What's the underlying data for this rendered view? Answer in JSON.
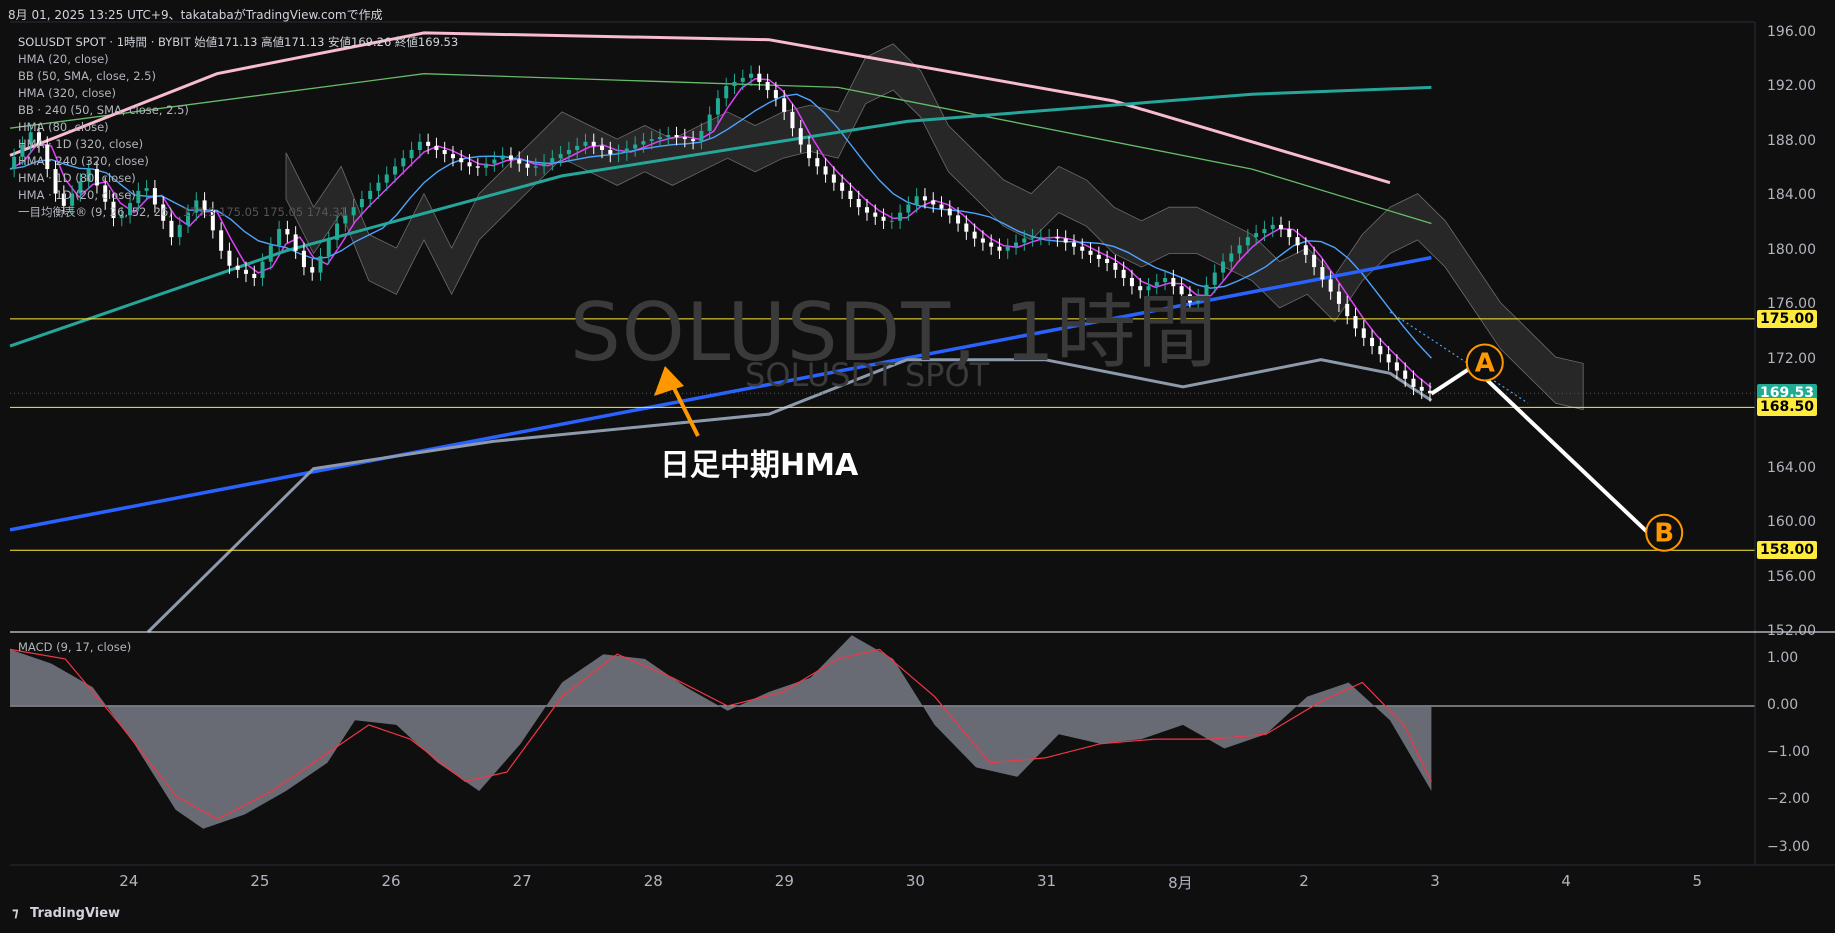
{
  "header": {
    "text": "8月 01, 2025 13:25 UTC+9、takatabaがTradingView.comで作成"
  },
  "legend": {
    "symbol_line": "SOLUSDT SPOT · 1時間 · BYBIT",
    "ohlc": "始値171.13 高値171.13 安値169.26 終値169.53",
    "items": [
      "HMA (20, close)",
      "BB (50, SMA, close, 2.5)",
      "HMA (320, close)",
      "BB · 240 (50, SMA, close, 2.5)",
      "HMA (80, close)",
      "HMA · 1D (320, close)",
      "HMA · 240 (320, close)",
      "HMA · 1D (80, close)",
      "HMA · 1D (20, close)",
      "一目均衡表® (9, 26, 52, 26)"
    ],
    "ichimoku_values": "173.3   175.05   175.05   174.31"
  },
  "watermark": {
    "main": "SOLUSDT, 1時間",
    "sub": "SOLUSDT SPOT"
  },
  "annotation": {
    "text": "日足中期HMA",
    "point_a": "A",
    "point_b": "B"
  },
  "price_tags": [
    {
      "label": "175.00",
      "value": 175.0,
      "bg": "#ffeb3b",
      "fg": "#000000"
    },
    {
      "label": "169.53",
      "value": 169.53,
      "bg": "#22ab94",
      "fg": "#ffffff"
    },
    {
      "label": "168.50",
      "value": 168.5,
      "bg": "#ffeb3b",
      "fg": "#000000"
    },
    {
      "label": "158.00",
      "value": 158.0,
      "bg": "#ffeb3b",
      "fg": "#000000"
    }
  ],
  "macd_label": "MACD (9, 17, close)",
  "footer": {
    "logo_text": "TradingView"
  },
  "colors": {
    "background": "#0f0f0f",
    "up_candle": "#22ab94",
    "down_candle": "#ffffff",
    "hma_pink": "#f8bbd0",
    "hma_teal": "#26a69a",
    "hma_blue_daily": "#2962ff",
    "hma_gray": "#8d9aab",
    "hma_magenta": "#e040fb",
    "hma_lightblue": "#4fa3ff",
    "hma_green": "#66bb6a",
    "horizontal_line": "#ffeb3b",
    "arrow": "#ff9800",
    "macd_hist": "#787b86",
    "macd_signal": "#f23645"
  },
  "chart_data": [
    {
      "type": "candlestick",
      "x_ticks": [
        "24",
        "25",
        "26",
        "27",
        "28",
        "29",
        "30",
        "31",
        "8月",
        "2",
        "3",
        "4",
        "5"
      ],
      "y_ticks": [
        "196.00",
        "192.00",
        "188.00",
        "184.00",
        "180.00",
        "176.00",
        "172.00",
        "164.00",
        "160.00",
        "156.00",
        "152.00"
      ],
      "ylim": [
        152,
        196.8
      ],
      "horizontal_levels": [
        175.0,
        168.5,
        158.0
      ],
      "last_price": 169.53,
      "close_path": [
        [
          0,
          186
        ],
        [
          4,
          189
        ],
        [
          8,
          183
        ],
        [
          12,
          186
        ],
        [
          16,
          182
        ],
        [
          20,
          185
        ],
        [
          24,
          181
        ],
        [
          28,
          184
        ],
        [
          32,
          179
        ],
        [
          36,
          178
        ],
        [
          40,
          182
        ],
        [
          44,
          178
        ],
        [
          48,
          182
        ],
        [
          52,
          184
        ],
        [
          56,
          186
        ],
        [
          60,
          188
        ],
        [
          64,
          187
        ],
        [
          68,
          186
        ],
        [
          72,
          187
        ],
        [
          76,
          186
        ],
        [
          80,
          187
        ],
        [
          84,
          188
        ],
        [
          88,
          187
        ],
        [
          92,
          188
        ],
        [
          96,
          188.5
        ],
        [
          100,
          188
        ],
        [
          104,
          192
        ],
        [
          108,
          193
        ],
        [
          112,
          191
        ],
        [
          116,
          187
        ],
        [
          120,
          185
        ],
        [
          124,
          183
        ],
        [
          128,
          182
        ],
        [
          132,
          184
        ],
        [
          136,
          183
        ],
        [
          140,
          181
        ],
        [
          144,
          180
        ],
        [
          148,
          181
        ],
        [
          152,
          181
        ],
        [
          156,
          180
        ],
        [
          160,
          179
        ],
        [
          164,
          177
        ],
        [
          168,
          178
        ],
        [
          172,
          176
        ],
        [
          176,
          179
        ],
        [
          180,
          181
        ],
        [
          184,
          182
        ],
        [
          188,
          180
        ],
        [
          192,
          177
        ],
        [
          196,
          174
        ],
        [
          200,
          172
        ],
        [
          204,
          170
        ],
        [
          206,
          169.53
        ]
      ],
      "projection": {
        "points": [
          [
            206,
            169.5
          ],
          [
            212,
            171.5
          ],
          [
            238,
            159.0
          ]
        ]
      }
    },
    {
      "type": "line",
      "name": "MACD (9, 17, close)",
      "y_ticks": [
        "1.00",
        "0.00",
        "−1.00",
        "−2.00",
        "−3.00"
      ],
      "ylim": [
        -3.2,
        1.4
      ],
      "histogram": [
        [
          0,
          1.2
        ],
        [
          6,
          0.9
        ],
        [
          12,
          0.4
        ],
        [
          18,
          -0.8
        ],
        [
          24,
          -2.2
        ],
        [
          28,
          -2.6
        ],
        [
          34,
          -2.3
        ],
        [
          40,
          -1.8
        ],
        [
          46,
          -1.2
        ],
        [
          50,
          -0.3
        ],
        [
          56,
          -0.4
        ],
        [
          62,
          -1.2
        ],
        [
          68,
          -1.8
        ],
        [
          74,
          -0.8
        ],
        [
          80,
          0.5
        ],
        [
          86,
          1.1
        ],
        [
          92,
          1.0
        ],
        [
          98,
          0.4
        ],
        [
          104,
          -0.1
        ],
        [
          110,
          0.3
        ],
        [
          116,
          0.6
        ],
        [
          122,
          1.5
        ],
        [
          128,
          1.0
        ],
        [
          134,
          -0.4
        ],
        [
          140,
          -1.3
        ],
        [
          146,
          -1.5
        ],
        [
          152,
          -0.6
        ],
        [
          158,
          -0.8
        ],
        [
          164,
          -0.7
        ],
        [
          170,
          -0.4
        ],
        [
          176,
          -0.9
        ],
        [
          182,
          -0.6
        ],
        [
          188,
          0.2
        ],
        [
          194,
          0.5
        ],
        [
          200,
          -0.3
        ],
        [
          206,
          -1.8
        ]
      ],
      "signal": [
        [
          0,
          1.2
        ],
        [
          8,
          1.0
        ],
        [
          16,
          -0.4
        ],
        [
          24,
          -1.9
        ],
        [
          30,
          -2.4
        ],
        [
          38,
          -1.8
        ],
        [
          46,
          -1.0
        ],
        [
          52,
          -0.4
        ],
        [
          58,
          -0.7
        ],
        [
          66,
          -1.6
        ],
        [
          72,
          -1.4
        ],
        [
          80,
          0.2
        ],
        [
          88,
          1.1
        ],
        [
          96,
          0.6
        ],
        [
          104,
          0.0
        ],
        [
          112,
          0.3
        ],
        [
          120,
          1.0
        ],
        [
          126,
          1.2
        ],
        [
          134,
          0.2
        ],
        [
          142,
          -1.2
        ],
        [
          150,
          -1.1
        ],
        [
          158,
          -0.8
        ],
        [
          166,
          -0.7
        ],
        [
          174,
          -0.7
        ],
        [
          182,
          -0.6
        ],
        [
          190,
          0.1
        ],
        [
          196,
          0.5
        ],
        [
          202,
          -0.4
        ],
        [
          206,
          -1.6
        ]
      ]
    }
  ]
}
